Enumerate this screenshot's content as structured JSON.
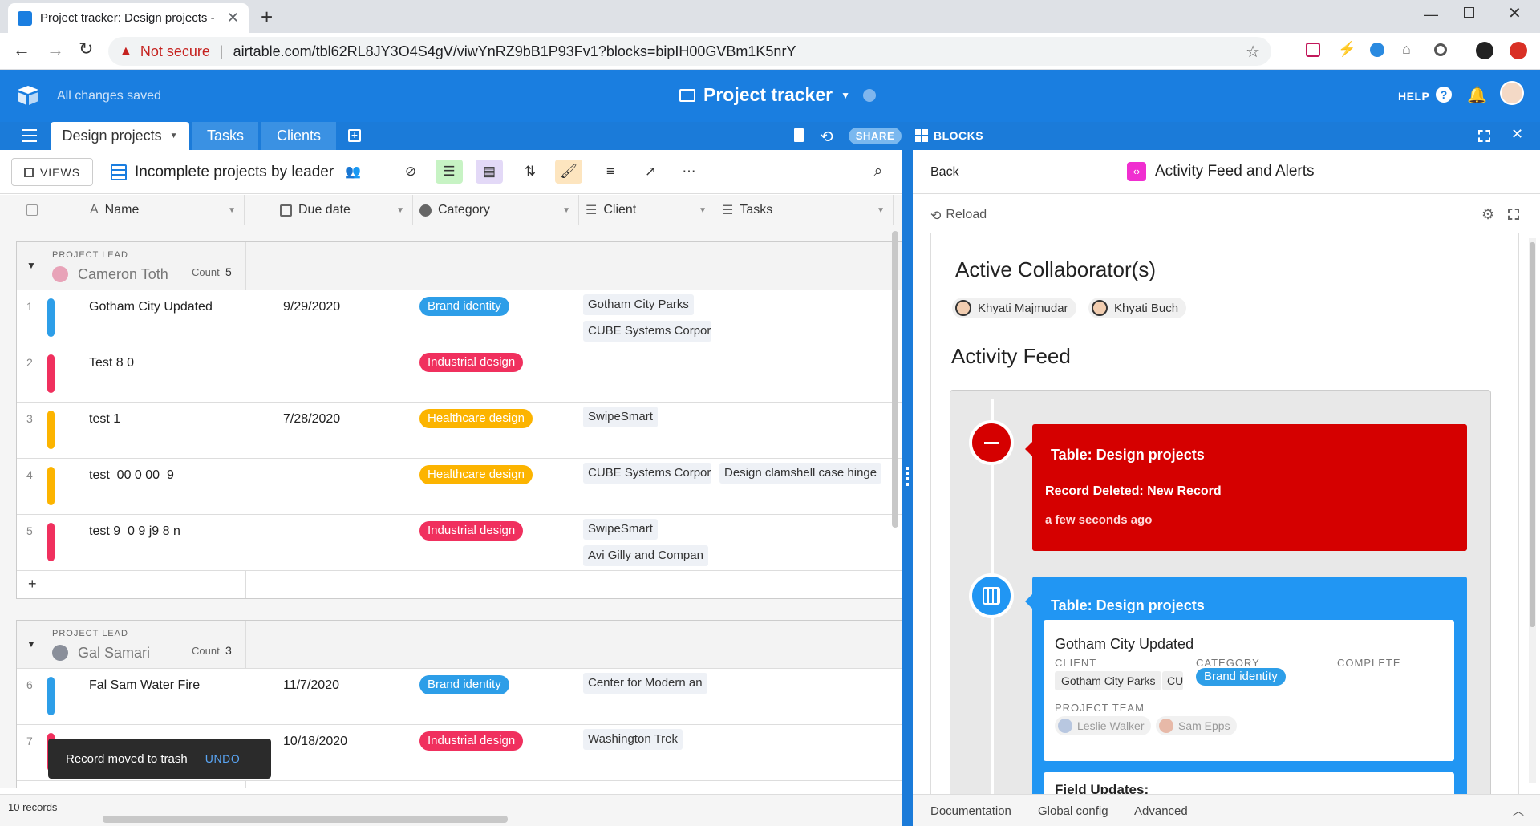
{
  "browser": {
    "tab_title": "Project tracker: Design projects -",
    "not_secure": "Not secure",
    "url": "airtable.com/tbl62RL8JY3O4S4gV/viwYnRZ9bB1P93Fv1?blocks=bipIH00GVBm1K5nrY"
  },
  "app": {
    "save_status": "All changes saved",
    "base_name": "Project tracker",
    "help_label": "HELP",
    "tabs": [
      "Design projects",
      "Tasks",
      "Clients"
    ],
    "share_label": "SHARE",
    "blocks_label": "BLOCKS"
  },
  "toolbar": {
    "views_label": "VIEWS",
    "view_name": "Incomplete projects by leader"
  },
  "columns": [
    "Name",
    "Due date",
    "Category",
    "Client",
    "Tasks"
  ],
  "groups": [
    {
      "label": "PROJECT LEAD",
      "lead": "Cameron Toth",
      "count_label": "Count",
      "count": "5",
      "rows": [
        {
          "num": "1",
          "name": "Gotham City Updated",
          "date": "9/29/2020",
          "category": "Brand identity",
          "cat_color": "#2d9ee8",
          "bar": "#2d9ee8",
          "clients": [
            "Gotham City Parks",
            "CUBE Systems Corpor"
          ],
          "tasks": []
        },
        {
          "num": "2",
          "name": "Test 8 0",
          "date": "",
          "category": "Industrial design",
          "cat_color": "#f0305e",
          "bar": "#f0305e",
          "clients": [],
          "tasks": []
        },
        {
          "num": "3",
          "name": "test 1",
          "date": "7/28/2020",
          "category": "Healthcare design",
          "cat_color": "#fcb400",
          "bar": "#fcb400",
          "clients": [
            "SwipeSmart"
          ],
          "tasks": []
        },
        {
          "num": "4",
          "name": "test  00 0 00  9",
          "date": "",
          "category": "Healthcare design",
          "cat_color": "#fcb400",
          "bar": "#fcb400",
          "clients": [
            "CUBE Systems Corpor"
          ],
          "tasks": [
            "Design clamshell case hinge"
          ]
        },
        {
          "num": "5",
          "name": "test 9  0 9 j9 8 n",
          "date": "",
          "category": "Industrial design",
          "cat_color": "#f0305e",
          "bar": "#f0305e",
          "clients": [
            "SwipeSmart",
            "Avi Gilly and Compan"
          ],
          "tasks": []
        }
      ]
    },
    {
      "label": "PROJECT LEAD",
      "lead": "Gal Samari",
      "count_label": "Count",
      "count": "3",
      "rows": [
        {
          "num": "6",
          "name": "Fal Sam Water Fire",
          "date": "11/7/2020",
          "category": "Brand identity",
          "cat_color": "#2d9ee8",
          "bar": "#2d9ee8",
          "clients": [
            "Center for Modern an"
          ],
          "tasks": []
        },
        {
          "num": "7",
          "name": "",
          "date": "10/18/2020",
          "category": "Industrial design",
          "cat_color": "#f0305e",
          "bar": "#f0305e",
          "clients": [
            "Washington Trek"
          ],
          "tasks": []
        }
      ]
    }
  ],
  "add_row": "+",
  "footer": {
    "records": "10 records"
  },
  "toast": {
    "message": "Record moved to trash",
    "action": "UNDO"
  },
  "panel": {
    "back": "Back",
    "block_title": "Activity Feed and Alerts",
    "reload": "Reload",
    "collaborators_title": "Active Collaborator(s)",
    "collaborators": [
      "Khyati Majmudar",
      "Khyati Buch"
    ],
    "feed_title": "Activity Feed",
    "deleted_card": {
      "table": "Table: Design projects",
      "action": "Record Deleted: New Record",
      "time": "a few seconds ago"
    },
    "updated_card": {
      "table": "Table: Design projects",
      "record_name": "Gotham City Updated",
      "client_label": "CLIENT",
      "category_label": "CATEGORY",
      "complete_label": "COMPLETE",
      "clients": [
        "Gotham City Parks",
        "CU"
      ],
      "category": "Brand identity",
      "team_label": "PROJECT TEAM",
      "team": [
        "Leslie Walker",
        "Sam Epps"
      ],
      "next_label": "Field Updates:"
    },
    "footer_links": [
      "Documentation",
      "Global config",
      "Advanced"
    ]
  },
  "colors": {
    "brand_blue": "#1a7ee0",
    "deleted_red": "#d50000",
    "updated_blue": "#2196f3"
  }
}
